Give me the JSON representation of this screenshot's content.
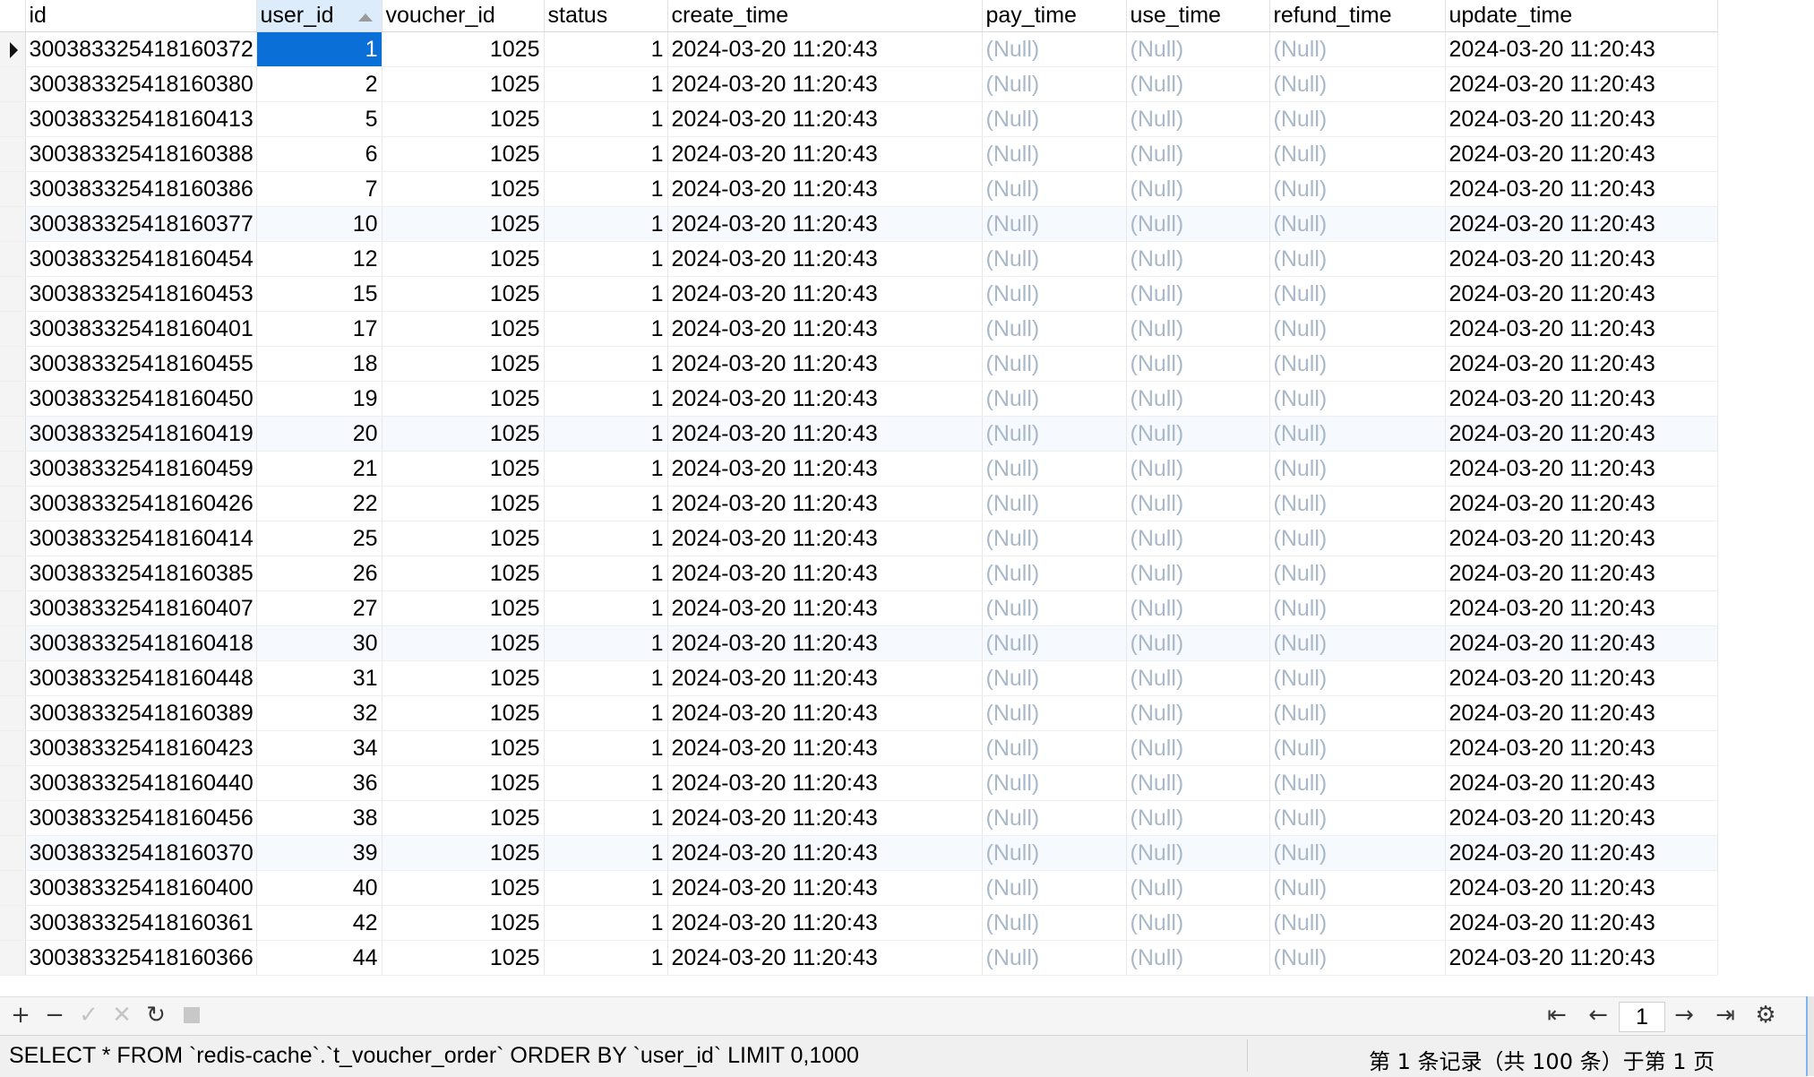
{
  "columns": [
    "id",
    "user_id",
    "voucher_id",
    "status",
    "create_time",
    "pay_time",
    "use_time",
    "refund_time",
    "update_time"
  ],
  "sorted_column": "user_id",
  "rows": [
    {
      "id": "300383325418160372",
      "user_id": "1",
      "voucher_id": "1025",
      "status": "1",
      "create_time": "2024-03-20 11:20:43",
      "pay_time": "(Null)",
      "use_time": "(Null)",
      "refund_time": "(Null)",
      "update_time": "2024-03-20 11:20:43"
    },
    {
      "id": "300383325418160380",
      "user_id": "2",
      "voucher_id": "1025",
      "status": "1",
      "create_time": "2024-03-20 11:20:43",
      "pay_time": "(Null)",
      "use_time": "(Null)",
      "refund_time": "(Null)",
      "update_time": "2024-03-20 11:20:43"
    },
    {
      "id": "300383325418160413",
      "user_id": "5",
      "voucher_id": "1025",
      "status": "1",
      "create_time": "2024-03-20 11:20:43",
      "pay_time": "(Null)",
      "use_time": "(Null)",
      "refund_time": "(Null)",
      "update_time": "2024-03-20 11:20:43"
    },
    {
      "id": "300383325418160388",
      "user_id": "6",
      "voucher_id": "1025",
      "status": "1",
      "create_time": "2024-03-20 11:20:43",
      "pay_time": "(Null)",
      "use_time": "(Null)",
      "refund_time": "(Null)",
      "update_time": "2024-03-20 11:20:43"
    },
    {
      "id": "300383325418160386",
      "user_id": "7",
      "voucher_id": "1025",
      "status": "1",
      "create_time": "2024-03-20 11:20:43",
      "pay_time": "(Null)",
      "use_time": "(Null)",
      "refund_time": "(Null)",
      "update_time": "2024-03-20 11:20:43"
    },
    {
      "id": "300383325418160377",
      "user_id": "10",
      "voucher_id": "1025",
      "status": "1",
      "create_time": "2024-03-20 11:20:43",
      "pay_time": "(Null)",
      "use_time": "(Null)",
      "refund_time": "(Null)",
      "update_time": "2024-03-20 11:20:43"
    },
    {
      "id": "300383325418160454",
      "user_id": "12",
      "voucher_id": "1025",
      "status": "1",
      "create_time": "2024-03-20 11:20:43",
      "pay_time": "(Null)",
      "use_time": "(Null)",
      "refund_time": "(Null)",
      "update_time": "2024-03-20 11:20:43"
    },
    {
      "id": "300383325418160453",
      "user_id": "15",
      "voucher_id": "1025",
      "status": "1",
      "create_time": "2024-03-20 11:20:43",
      "pay_time": "(Null)",
      "use_time": "(Null)",
      "refund_time": "(Null)",
      "update_time": "2024-03-20 11:20:43"
    },
    {
      "id": "300383325418160401",
      "user_id": "17",
      "voucher_id": "1025",
      "status": "1",
      "create_time": "2024-03-20 11:20:43",
      "pay_time": "(Null)",
      "use_time": "(Null)",
      "refund_time": "(Null)",
      "update_time": "2024-03-20 11:20:43"
    },
    {
      "id": "300383325418160455",
      "user_id": "18",
      "voucher_id": "1025",
      "status": "1",
      "create_time": "2024-03-20 11:20:43",
      "pay_time": "(Null)",
      "use_time": "(Null)",
      "refund_time": "(Null)",
      "update_time": "2024-03-20 11:20:43"
    },
    {
      "id": "300383325418160450",
      "user_id": "19",
      "voucher_id": "1025",
      "status": "1",
      "create_time": "2024-03-20 11:20:43",
      "pay_time": "(Null)",
      "use_time": "(Null)",
      "refund_time": "(Null)",
      "update_time": "2024-03-20 11:20:43"
    },
    {
      "id": "300383325418160419",
      "user_id": "20",
      "voucher_id": "1025",
      "status": "1",
      "create_time": "2024-03-20 11:20:43",
      "pay_time": "(Null)",
      "use_time": "(Null)",
      "refund_time": "(Null)",
      "update_time": "2024-03-20 11:20:43"
    },
    {
      "id": "300383325418160459",
      "user_id": "21",
      "voucher_id": "1025",
      "status": "1",
      "create_time": "2024-03-20 11:20:43",
      "pay_time": "(Null)",
      "use_time": "(Null)",
      "refund_time": "(Null)",
      "update_time": "2024-03-20 11:20:43"
    },
    {
      "id": "300383325418160426",
      "user_id": "22",
      "voucher_id": "1025",
      "status": "1",
      "create_time": "2024-03-20 11:20:43",
      "pay_time": "(Null)",
      "use_time": "(Null)",
      "refund_time": "(Null)",
      "update_time": "2024-03-20 11:20:43"
    },
    {
      "id": "300383325418160414",
      "user_id": "25",
      "voucher_id": "1025",
      "status": "1",
      "create_time": "2024-03-20 11:20:43",
      "pay_time": "(Null)",
      "use_time": "(Null)",
      "refund_time": "(Null)",
      "update_time": "2024-03-20 11:20:43"
    },
    {
      "id": "300383325418160385",
      "user_id": "26",
      "voucher_id": "1025",
      "status": "1",
      "create_time": "2024-03-20 11:20:43",
      "pay_time": "(Null)",
      "use_time": "(Null)",
      "refund_time": "(Null)",
      "update_time": "2024-03-20 11:20:43"
    },
    {
      "id": "300383325418160407",
      "user_id": "27",
      "voucher_id": "1025",
      "status": "1",
      "create_time": "2024-03-20 11:20:43",
      "pay_time": "(Null)",
      "use_time": "(Null)",
      "refund_time": "(Null)",
      "update_time": "2024-03-20 11:20:43"
    },
    {
      "id": "300383325418160418",
      "user_id": "30",
      "voucher_id": "1025",
      "status": "1",
      "create_time": "2024-03-20 11:20:43",
      "pay_time": "(Null)",
      "use_time": "(Null)",
      "refund_time": "(Null)",
      "update_time": "2024-03-20 11:20:43"
    },
    {
      "id": "300383325418160448",
      "user_id": "31",
      "voucher_id": "1025",
      "status": "1",
      "create_time": "2024-03-20 11:20:43",
      "pay_time": "(Null)",
      "use_time": "(Null)",
      "refund_time": "(Null)",
      "update_time": "2024-03-20 11:20:43"
    },
    {
      "id": "300383325418160389",
      "user_id": "32",
      "voucher_id": "1025",
      "status": "1",
      "create_time": "2024-03-20 11:20:43",
      "pay_time": "(Null)",
      "use_time": "(Null)",
      "refund_time": "(Null)",
      "update_time": "2024-03-20 11:20:43"
    },
    {
      "id": "300383325418160423",
      "user_id": "34",
      "voucher_id": "1025",
      "status": "1",
      "create_time": "2024-03-20 11:20:43",
      "pay_time": "(Null)",
      "use_time": "(Null)",
      "refund_time": "(Null)",
      "update_time": "2024-03-20 11:20:43"
    },
    {
      "id": "300383325418160440",
      "user_id": "36",
      "voucher_id": "1025",
      "status": "1",
      "create_time": "2024-03-20 11:20:43",
      "pay_time": "(Null)",
      "use_time": "(Null)",
      "refund_time": "(Null)",
      "update_time": "2024-03-20 11:20:43"
    },
    {
      "id": "300383325418160456",
      "user_id": "38",
      "voucher_id": "1025",
      "status": "1",
      "create_time": "2024-03-20 11:20:43",
      "pay_time": "(Null)",
      "use_time": "(Null)",
      "refund_time": "(Null)",
      "update_time": "2024-03-20 11:20:43"
    },
    {
      "id": "300383325418160370",
      "user_id": "39",
      "voucher_id": "1025",
      "status": "1",
      "create_time": "2024-03-20 11:20:43",
      "pay_time": "(Null)",
      "use_time": "(Null)",
      "refund_time": "(Null)",
      "update_time": "2024-03-20 11:20:43"
    },
    {
      "id": "300383325418160400",
      "user_id": "40",
      "voucher_id": "1025",
      "status": "1",
      "create_time": "2024-03-20 11:20:43",
      "pay_time": "(Null)",
      "use_time": "(Null)",
      "refund_time": "(Null)",
      "update_time": "2024-03-20 11:20:43"
    },
    {
      "id": "300383325418160361",
      "user_id": "42",
      "voucher_id": "1025",
      "status": "1",
      "create_time": "2024-03-20 11:20:43",
      "pay_time": "(Null)",
      "use_time": "(Null)",
      "refund_time": "(Null)",
      "update_time": "2024-03-20 11:20:43"
    },
    {
      "id": "300383325418160366",
      "user_id": "44",
      "voucher_id": "1025",
      "status": "1",
      "create_time": "2024-03-20 11:20:43",
      "pay_time": "(Null)",
      "use_time": "(Null)",
      "refund_time": "(Null)",
      "update_time": "2024-03-20 11:20:43"
    }
  ],
  "toolbar": {
    "add_icon": "plus-icon",
    "delete_icon": "minus-icon",
    "apply_icon": "check-icon",
    "discard_icon": "x-icon",
    "refresh_icon": "refresh-icon",
    "stop_icon": "stop-icon",
    "first_icon": "first-page-icon",
    "prev_icon": "prev-page-icon",
    "page_value": "1",
    "next_icon": "next-page-icon",
    "last_icon": "last-page-icon",
    "settings_icon": "gear-icon"
  },
  "status_bar": {
    "sql": "SELECT * FROM `redis-cache`.`t_voucher_order` ORDER BY `user_id` LIMIT 0,1000",
    "record_info": "第 1 条记录（共 100 条）于第 1 页"
  },
  "colors": {
    "selected_cell": "#0a6fd6",
    "null_text": "#a8b8c8",
    "sorted_header": "#dcecfb"
  }
}
